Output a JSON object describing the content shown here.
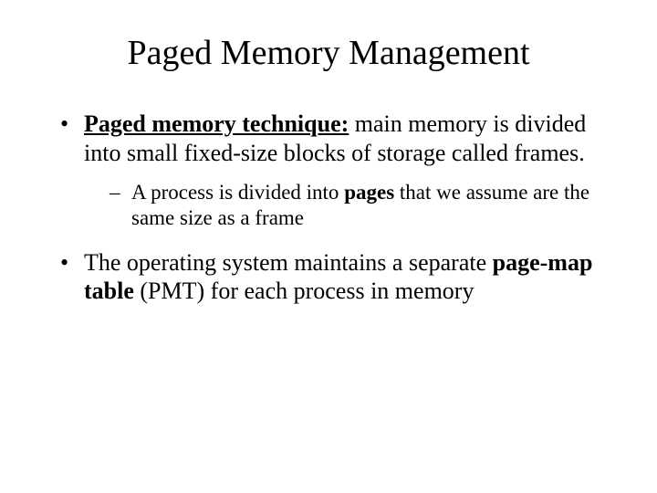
{
  "title": "Paged Memory Management",
  "b1": {
    "lead": "Paged memory technique:",
    "rest": " main memory is divided into small fixed-size blocks of storage called frames."
  },
  "b1sub": {
    "pre": "A process is divided into ",
    "bold": "pages",
    "post": " that we assume are the same size as a frame"
  },
  "b2": {
    "pre": "The operating system maintains a separate ",
    "bold": "page-map table",
    "post": " (PMT) for each process in memory"
  }
}
